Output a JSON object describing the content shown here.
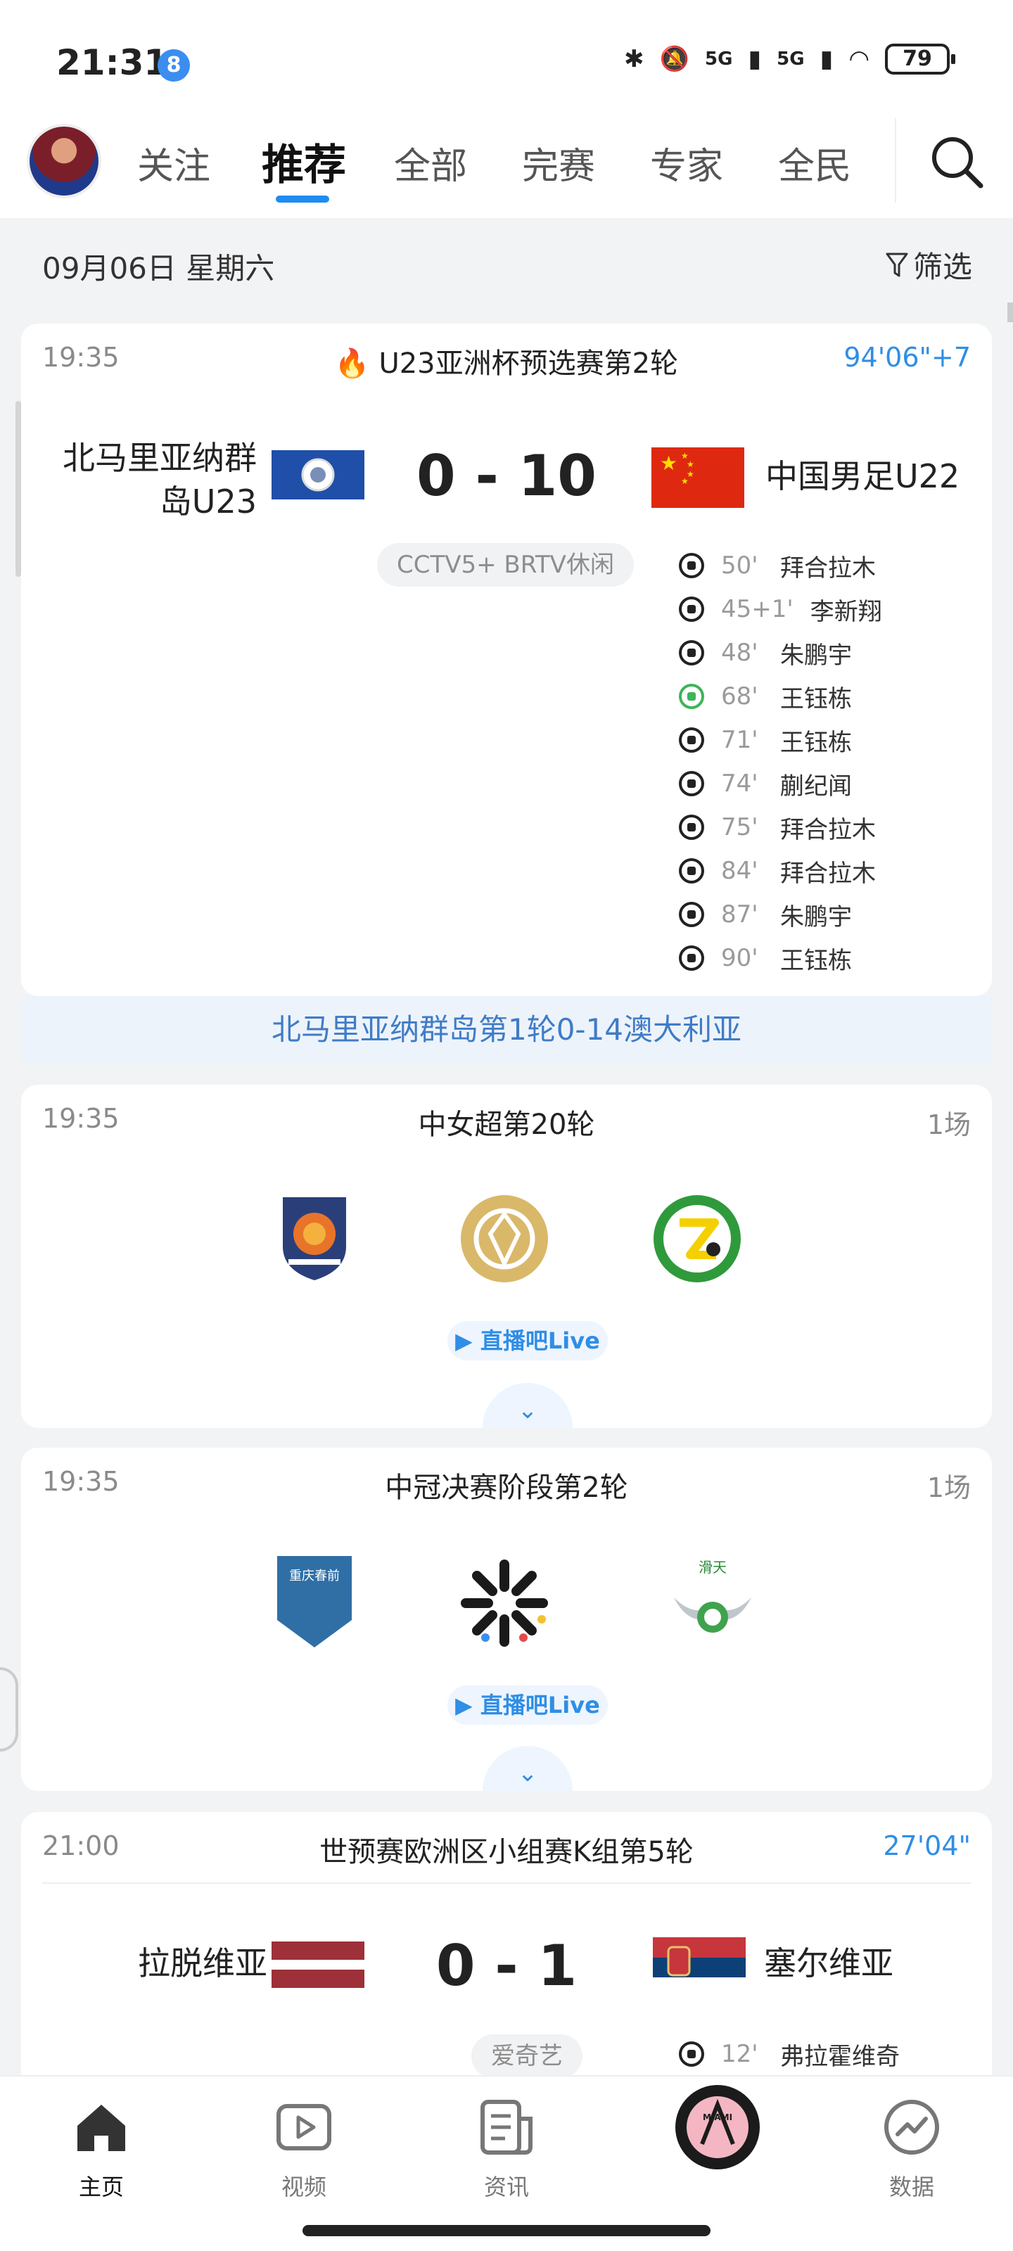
{
  "status_bar": {
    "time": "21:31",
    "app_badge": "8",
    "signal_1": "5G",
    "signal_2": "5G",
    "battery": "79"
  },
  "nav": {
    "tabs": [
      "关注",
      "推荐",
      "全部",
      "完赛",
      "专家",
      "全民"
    ],
    "active_tab": "推荐"
  },
  "date_bar": {
    "date": "09月06日 星期六",
    "filter_label": "筛选"
  },
  "match1": {
    "time": "19:35",
    "league": "U23亚洲杯预选赛第2轮",
    "status": "94'06\"+7",
    "home_name_line1": "北马里亚纳群",
    "home_name_line2": "岛U23",
    "away_name": "中国男足U22",
    "score": "0 - 10",
    "tv": "CCTV5+  BRTV休闲",
    "goals": [
      {
        "minute": "50'",
        "player": "拜合拉木",
        "type": "goal"
      },
      {
        "minute": "45+1'",
        "player": "李新翔",
        "type": "goal"
      },
      {
        "minute": "48'",
        "player": "朱鹏宇",
        "type": "goal"
      },
      {
        "minute": "68'",
        "player": "王钰栋",
        "type": "own-goal"
      },
      {
        "minute": "71'",
        "player": "王钰栋",
        "type": "goal"
      },
      {
        "minute": "74'",
        "player": "蒯纪闻",
        "type": "goal"
      },
      {
        "minute": "75'",
        "player": "拜合拉木",
        "type": "goal"
      },
      {
        "minute": "84'",
        "player": "拜合拉木",
        "type": "goal"
      },
      {
        "minute": "87'",
        "player": "朱鹏宇",
        "type": "goal"
      },
      {
        "minute": "90'",
        "player": "王钰栋",
        "type": "goal"
      }
    ],
    "h2h_note": "北马里亚纳群岛第1轮0-14澳大利亚"
  },
  "match2": {
    "time": "19:35",
    "league": "中女超第20轮",
    "count": "1场",
    "live_label": "直播吧Live"
  },
  "match3": {
    "time": "19:35",
    "league": "中冠决赛阶段第2轮",
    "count": "1场",
    "live_label": "直播吧Live",
    "logo_text_left": "重庆春前",
    "logo_text_right": "滑天"
  },
  "match4": {
    "time": "21:00",
    "league": "世预赛欧洲区小组赛K组第5轮",
    "status": "27'04\"",
    "home_name": "拉脱维亚",
    "away_name": "塞尔维亚",
    "score": "0 - 1",
    "tv": "爱奇艺",
    "goals": [
      {
        "minute": "12'",
        "player": "弗拉霍维奇",
        "type": "goal"
      }
    ]
  },
  "bottom_nav": {
    "items": [
      "主页",
      "视频",
      "资讯",
      "",
      "数据"
    ],
    "center_badge": "MIAMI"
  },
  "colors": {
    "accent": "#1e8cf0",
    "live_blue": "#2f8ee6",
    "page_bg": "#f2f3f5"
  }
}
